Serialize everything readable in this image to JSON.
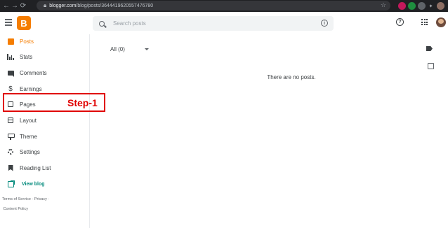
{
  "browser": {
    "url_domain": "blogger.com",
    "url_path": "/blog/posts/3644419620557476780"
  },
  "header": {
    "logo_letter": "B",
    "search_placeholder": "Search posts",
    "info_glyph": "i",
    "help_glyph": "?"
  },
  "sidebar": {
    "items": [
      {
        "label": "Posts",
        "icon": "posts-icon",
        "active": true
      },
      {
        "label": "Stats",
        "icon": "stats-icon"
      },
      {
        "label": "Comments",
        "icon": "comments-icon"
      },
      {
        "label": "Earnings",
        "icon": "dollar-icon"
      },
      {
        "label": "Pages",
        "icon": "pages-icon"
      },
      {
        "label": "Layout",
        "icon": "layout-icon"
      },
      {
        "label": "Theme",
        "icon": "paint-roller-icon"
      },
      {
        "label": "Settings",
        "icon": "gear-icon"
      },
      {
        "label": "Reading List",
        "icon": "bookmark-icon"
      }
    ],
    "view_blog": "View blog",
    "footer": {
      "terms": "Terms of Service",
      "privacy": "Privacy",
      "content_policy": "Content Policy"
    }
  },
  "annotation": {
    "step_label": "Step-1",
    "color": "#e00000"
  },
  "main": {
    "filter_label": "All (0)",
    "empty_message": "There are no posts."
  },
  "colors": {
    "brand": "#f57d00",
    "view_blog": "#00897b"
  }
}
